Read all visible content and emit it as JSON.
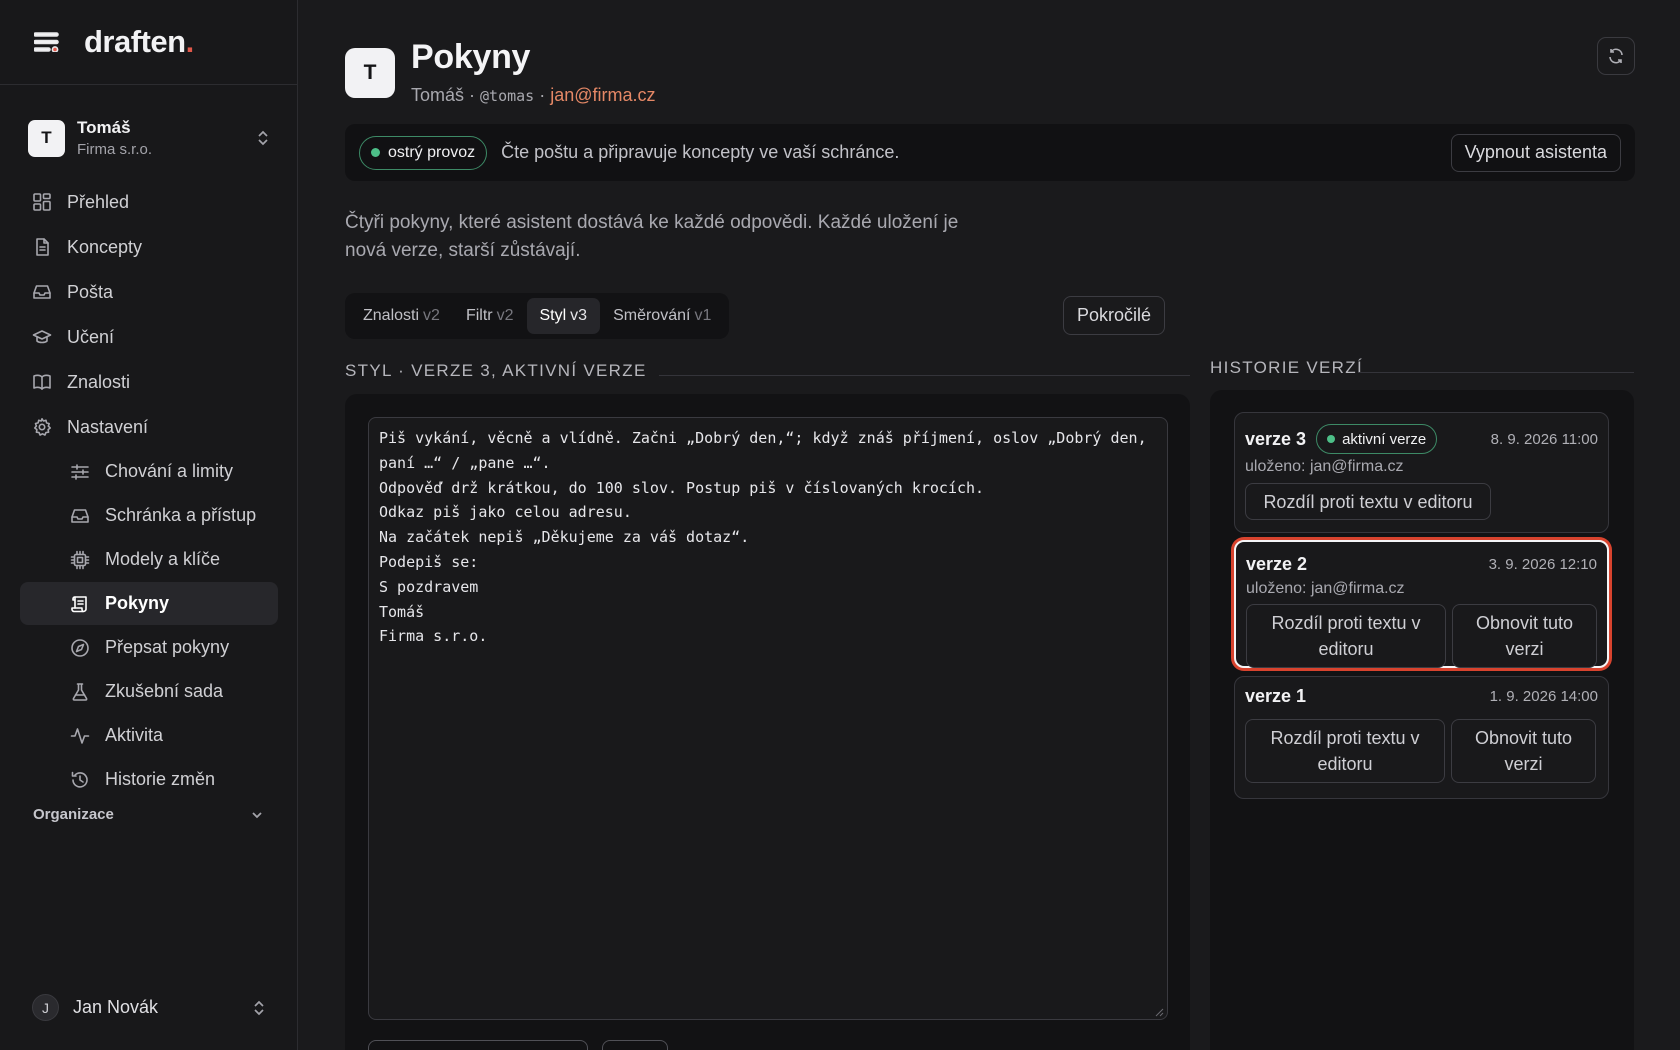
{
  "app": {
    "logo_text": "draften",
    "logo_dot": ".",
    "accent": "#e0584a"
  },
  "workspace": {
    "avatar": "T",
    "name": "Tomáš",
    "org": "Firma s.r.o."
  },
  "nav": {
    "items": [
      {
        "label": "Přehled",
        "icon": "grid-icon"
      },
      {
        "label": "Koncepty",
        "icon": "document-icon"
      },
      {
        "label": "Pošta",
        "icon": "inbox-icon"
      },
      {
        "label": "Učení",
        "icon": "graduation-cap-icon"
      },
      {
        "label": "Znalosti",
        "icon": "book-icon"
      },
      {
        "label": "Nastavení",
        "icon": "gear-icon"
      }
    ],
    "sub_items": [
      {
        "label": "Chování a limity",
        "icon": "sliders-icon"
      },
      {
        "label": "Schránka a přístup",
        "icon": "inbox-icon"
      },
      {
        "label": "Modely a klíče",
        "icon": "chip-icon"
      },
      {
        "label": "Pokyny",
        "icon": "scroll-icon",
        "active": true
      },
      {
        "label": "Přepsat pokyny",
        "icon": "compass-icon"
      },
      {
        "label": "Zkušební sada",
        "icon": "flask-icon"
      },
      {
        "label": "Aktivita",
        "icon": "activity-icon"
      },
      {
        "label": "Historie změn",
        "icon": "history-icon"
      }
    ],
    "organization_label": "Organizace"
  },
  "user": {
    "avatar": "J",
    "name": "Jan Novák"
  },
  "header": {
    "avatar": "T",
    "title": "Pokyny",
    "name": "Tomáš",
    "sep": " · ",
    "handle": "@tomas",
    "email": "jan@firma.cz"
  },
  "status": {
    "pill": "ostrý provoz",
    "text": "Čte poštu a připravuje koncepty ve vaší schránce.",
    "button": "Vypnout asistenta"
  },
  "intro": "Čtyři pokyny, které asistent dostává ke každé odpovědi. Každé uložení je nová verze, starší zůstávají.",
  "tabs": [
    {
      "label": "Znalosti",
      "version": "v2"
    },
    {
      "label": "Filtr",
      "version": "v2"
    },
    {
      "label": "Styl",
      "version": "v3",
      "active": true
    },
    {
      "label": "Směrování",
      "version": "v1"
    }
  ],
  "advanced_button": "Pokročilé",
  "editor": {
    "section_label": "STYL · VERZE 3, AKTIVNÍ VERZE",
    "text": "Piš vykání, věcně a vlídně. Začni „Dobrý den,“; když znáš příjmení, oslov „Dobrý den, paní …“ / „pane …“.\nOdpověď drž krátkou, do 100 slov. Postup piš v číslovaných krocích.\nOdkaz piš jako celou adresu.\nNa začátek nepiš „Děkujeme za váš dotaz“.\nPodepiš se:\nS pozdravem\nTomáš\nFirma s.r.o."
  },
  "history": {
    "section_label": "HISTORIE VERZÍ",
    "versions": [
      {
        "name": "verze 3",
        "badge": "aktivní verze",
        "date": "8. 9. 2026 11:00",
        "saved": "uloženo: jan@firma.cz",
        "diff_button": "Rozdíl proti textu v editoru"
      },
      {
        "name": "verze 2",
        "date": "3. 9. 2026 12:10",
        "saved": "uloženo: jan@firma.cz",
        "diff_button": "Rozdíl proti textu v editoru",
        "restore_button": "Obnovit tuto verzi",
        "selected": true
      },
      {
        "name": "verze 1",
        "date": "1. 9. 2026 14:00",
        "diff_button": "Rozdíl proti textu v editoru",
        "restore_button": "Obnovit tuto verzi"
      }
    ]
  }
}
